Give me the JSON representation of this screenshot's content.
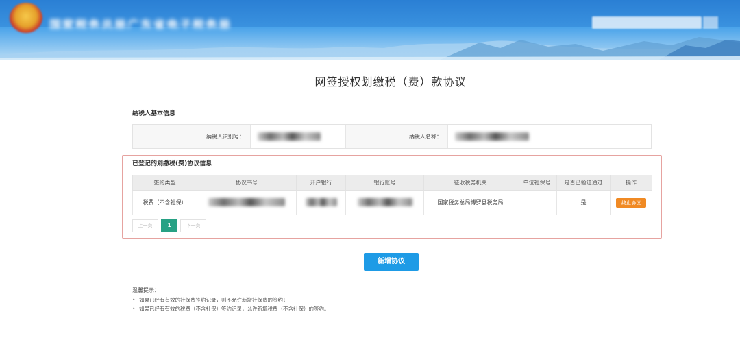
{
  "header": {
    "site_title": "国家税务总局广东省电子税务局",
    "brand_color": "#3b8fdc"
  },
  "page_title": "网签授权划缴税（费）款协议",
  "basic_info": {
    "section_label": "纳税人基本信息",
    "taxpayer_id_label": "纳税人识别号：",
    "taxpayer_name_label": "纳税人名称："
  },
  "agreements": {
    "section_label": "已登记的划缴税(费)协议信息",
    "columns": [
      "签约类型",
      "协议书号",
      "开户银行",
      "银行账号",
      "征收税务机关",
      "单位社保号",
      "是否已验证通过",
      "操作"
    ],
    "rows": [
      {
        "type": "税费（不含社保）",
        "tax_office": "国家税务总局博罗县税务局",
        "verified": "是",
        "action": "终止协议"
      }
    ],
    "action_color": "#f08a24"
  },
  "pagination": {
    "prev": "上一页",
    "current": "1",
    "next": "下一页",
    "active_color": "#27a184"
  },
  "add_button": {
    "label": "新增协议",
    "color": "#1e9be6"
  },
  "tips": {
    "title": "温馨提示：",
    "items": [
      "如果已经有有效的社保费签约记录，则不允许新增社保费的签约；",
      "如果已经有有效的税费（不含社保）签约记录，允许新增税费（不含社保）的签约。"
    ]
  }
}
